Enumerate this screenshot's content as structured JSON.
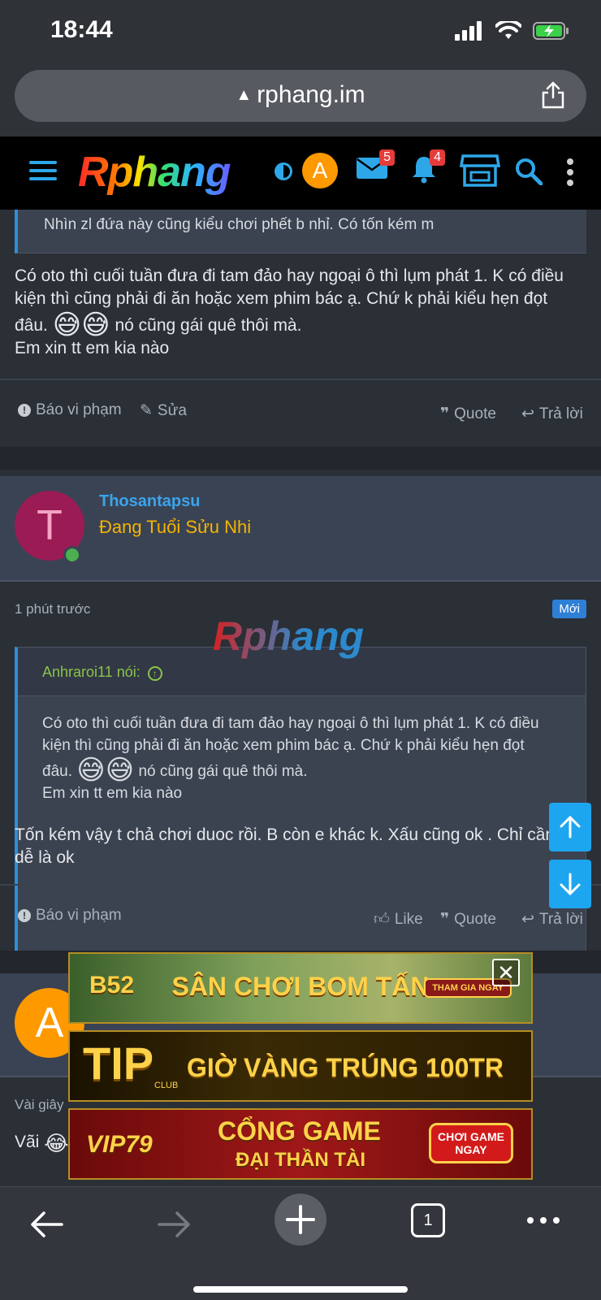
{
  "status": {
    "time": "18:44"
  },
  "browser": {
    "url": "rphang.im",
    "tab_count": "1"
  },
  "header": {
    "logo": "Rphang",
    "avatar_letter": "A",
    "messages_badge": "5",
    "alerts_badge": "4"
  },
  "post1": {
    "quote_snippet": "Nhìn zl đứa này cũng kiểu chơi phết b nhỉ. Có tốn kém m",
    "line1": "Có oto thì cuối tuần đưa đi tam đảo hay ngoại ô thì lụm phát 1. K có điều kiện thì cũng phải đi ăn hoặc xem phim bác ạ. Chứ k phải kiểu hẹn đọt",
    "line2_pre": "đâu.",
    "line2_emoji": "😅😅",
    "line2_post": "nó cũng gái quê thôi mà.",
    "line3": "Em xin tt em kia nào",
    "actions": {
      "report": "Báo vi phạm",
      "edit": "Sửa",
      "quote": "Quote",
      "reply": "Trả lời"
    }
  },
  "post2": {
    "avatar_letter": "T",
    "username": "Thosantapsu",
    "user_title": "Đang Tuổi Sửu Nhi",
    "time": "1 phút trước",
    "new_label": "Mới",
    "watermark": "Rphang",
    "quote_author": "Anhraroi11 nói:",
    "quote_line1": "Có oto thì cuối tuần đưa đi tam đảo hay ngoại ô thì lụm phát 1. K có điều kiện thì cũng phải đi ăn hoặc xem phim bác ạ. Chứ k phải kiểu hẹn đọt",
    "quote_line2_pre": "đâu.",
    "quote_line2_emoji": "😅😅",
    "quote_line2_post": "nó cũng gái quê thôi mà.",
    "quote_line3": "Em xin tt em kia nào",
    "body": "Tốn kém vậy t chả chơi duoc rồi. B còn e khác k. Xấu cũng ok . Chỉ cần dễ là ok",
    "actions": {
      "report": "Báo vi phạm",
      "like": "Like",
      "quote": "Quote",
      "reply": "Trả lời"
    }
  },
  "post3": {
    "avatar_letter": "A",
    "time": "Vài giây",
    "body": "Vãi",
    "emoji": "😂"
  },
  "ads": [
    {
      "text": "SÂN CHƠI BOM TẤN",
      "brand": "B52",
      "cta": "THAM GIA NGAY"
    },
    {
      "text": "GIỜ VÀNG TRÚNG 100TR",
      "brand": "TIP",
      "sub": "CLUB"
    },
    {
      "text": "CỔNG GAME",
      "sub": "ĐẠI THẦN TÀI",
      "brand": "VIP79",
      "cta": "CHƠI GAME NGAY"
    }
  ],
  "colors": {
    "link_blue": "#3ba5ec",
    "title_gold": "#f5b400",
    "accent_blue": "#1ea5f0"
  }
}
